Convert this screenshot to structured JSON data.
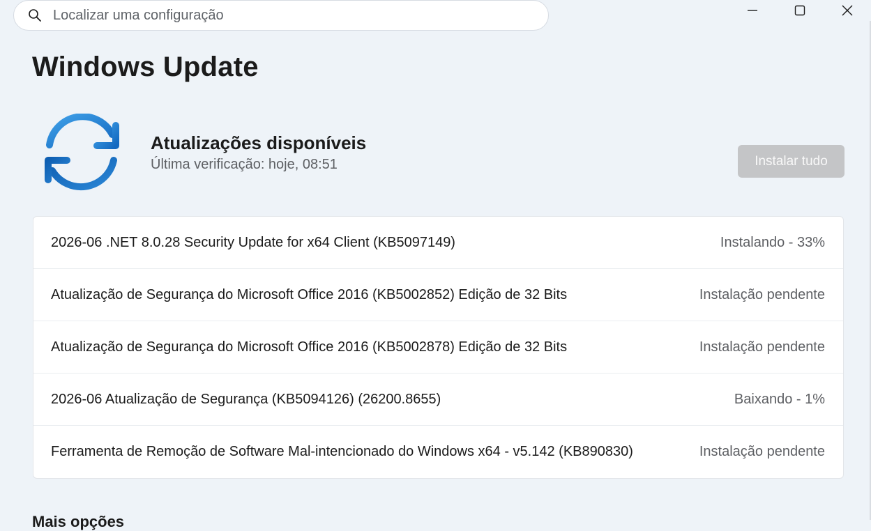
{
  "search": {
    "placeholder": "Localizar uma configuração",
    "icon": "search-icon"
  },
  "window_controls": {
    "minimize_icon": "minimize-icon",
    "maximize_icon": "maximize-icon",
    "close_icon": "close-icon"
  },
  "page": {
    "title": "Windows Update"
  },
  "status": {
    "icon": "sync-icon",
    "title": "Atualizações disponíveis",
    "subtitle": "Última verificação: hoje, 08:51",
    "install_all_label": "Instalar tudo"
  },
  "updates": [
    {
      "name": "2026-06 .NET 8.0.28 Security Update for x64 Client (KB5097149)",
      "status": "Instalando - 33%"
    },
    {
      "name": "Atualização de Segurança do Microsoft Office 2016 (KB5002852) Edição de 32 Bits",
      "status": "Instalação pendente"
    },
    {
      "name": "Atualização de Segurança do Microsoft Office 2016 (KB5002878) Edição de 32 Bits",
      "status": "Instalação pendente"
    },
    {
      "name": "2026-06 Atualização de Segurança (KB5094126) (26200.8655)",
      "status": "Baixando - 1%"
    },
    {
      "name": "Ferramenta de Remoção de Software Mal-intencionado do Windows x64 - v5.142 (KB890830)",
      "status": "Instalação pendente"
    }
  ],
  "more_options": {
    "heading": "Mais opções"
  },
  "colors": {
    "background": "#eef3f8",
    "accent_blue": "#1a73c8",
    "install_button_disabled": "#c4c5c7"
  }
}
